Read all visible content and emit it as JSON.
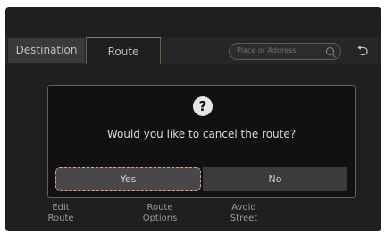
{
  "tabs": [
    {
      "label": "Destination"
    },
    {
      "label": "Route"
    }
  ],
  "search": {
    "placeholder": "Place or Address"
  },
  "dialog": {
    "question_glyph": "?",
    "message": "Would you like to cancel the route?",
    "yes_label": "Yes",
    "no_label": "No"
  },
  "menu": [
    {
      "line1": "Edit",
      "line2": "Route"
    },
    {
      "line1": "Route",
      "line2": "Options"
    },
    {
      "line1": "Avoid",
      "line2": "Street"
    }
  ],
  "back_glyph": "⮌",
  "colors": {
    "focus_outline": "#e7a27a",
    "tab_accent": "#9a7a53",
    "background": "#1f1f21"
  }
}
